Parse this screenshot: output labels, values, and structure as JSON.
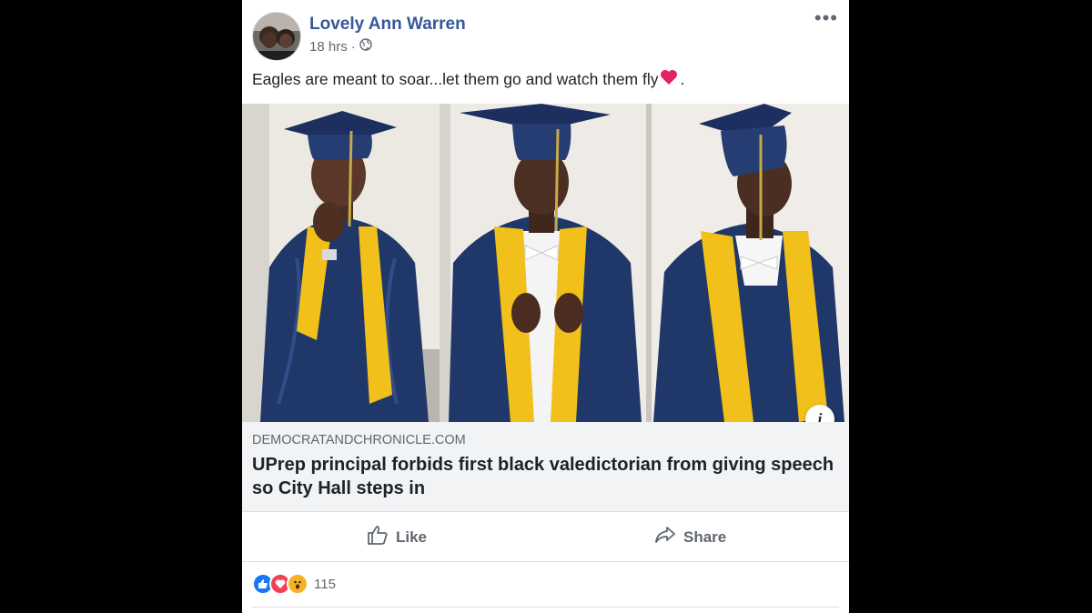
{
  "post": {
    "author": "Lovely Ann Warren",
    "time": "18 hrs",
    "meta_separator": " · ",
    "privacy_icon": "globe-icon",
    "more_label": "•••",
    "caption": "Eagles are meant to soar...let them go and watch them fly",
    "caption_end": ".",
    "caption_emoji": "heart-emoji",
    "heart_color": "#e0245e"
  },
  "images": [
    {
      "name": "graduate-photo-left",
      "gown_color": "#1f3566",
      "stole_color": "#f2c01a"
    },
    {
      "name": "graduate-photo-center",
      "gown_color": "#1f3566",
      "stole_color": "#f2c01a"
    },
    {
      "name": "graduate-photo-right",
      "gown_color": "#1f3566",
      "stole_color": "#f2c01a"
    }
  ],
  "link": {
    "domain": "DEMOCRATANDCHRONICLE.COM",
    "headline": "UPrep principal forbids first black valedictorian from giving speech so City Hall steps in",
    "info_label": "i"
  },
  "actions": {
    "like_label": "Like",
    "share_label": "Share"
  },
  "reactions": {
    "count": "115",
    "types": [
      "like-reaction-icon",
      "love-reaction-icon",
      "wow-reaction-icon"
    ],
    "colors": {
      "like": "#1877f2",
      "love": "#f33e58",
      "wow": "#f7b125"
    }
  },
  "colors": {
    "author_link": "#365899",
    "meta_text": "#616770",
    "link_box_bg": "#f2f3f5"
  }
}
